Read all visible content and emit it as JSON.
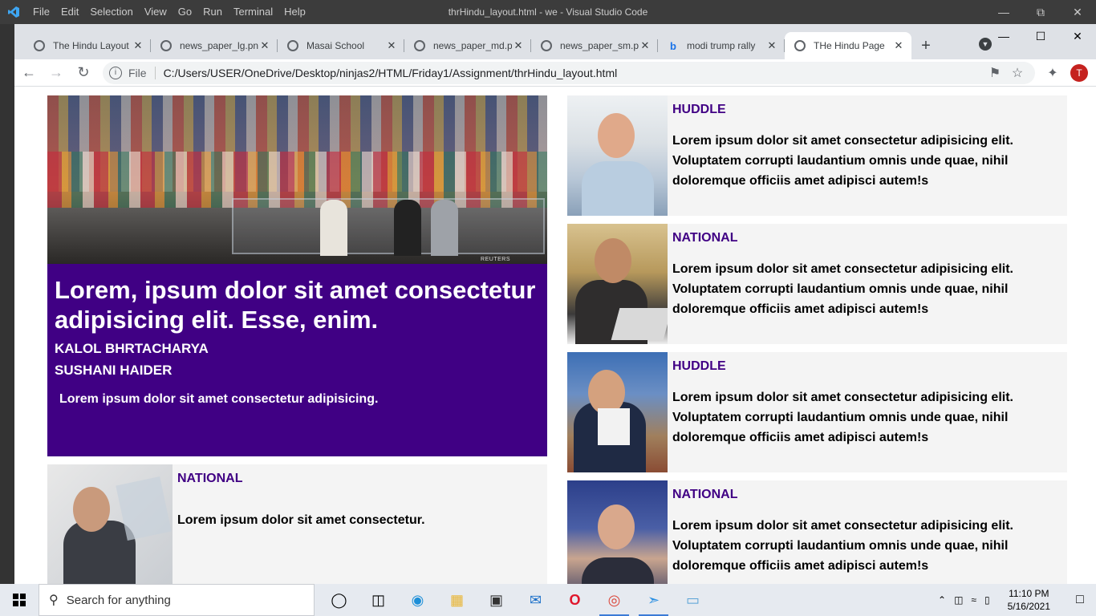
{
  "vscode": {
    "menu": [
      "File",
      "Edit",
      "Selection",
      "View",
      "Go",
      "Run",
      "Terminal",
      "Help"
    ],
    "title": "thrHindu_layout.html - we - Visual Studio Code"
  },
  "browser": {
    "tabs": [
      {
        "label": "The Hindu Layout",
        "icon": "globe-icon"
      },
      {
        "label": "news_paper_lg.png",
        "icon": "globe-icon"
      },
      {
        "label": "Masai School",
        "icon": "globe-icon"
      },
      {
        "label": "news_paper_md.png",
        "icon": "globe-icon"
      },
      {
        "label": "news_paper_sm.png",
        "icon": "globe-icon"
      },
      {
        "label": "modi trump rally",
        "icon": "bing-icon"
      },
      {
        "label": "THe Hindu Page",
        "icon": "globe-icon",
        "active": true
      }
    ],
    "address": {
      "scheme_label": "File",
      "url": "C:/Users/USER/OneDrive/Desktop/ninjas2/HTML/Friday1/Assignment/thrHindu_layout.html"
    },
    "profile_initial": "T"
  },
  "page": {
    "hero": {
      "image_credit": "REUTERS",
      "title": "Lorem, ipsum dolor sit amet consectetur adipisicing elit. Esse, enim.",
      "authors": [
        "KALOL BHRTACHARYA",
        "SUSHANI HAIDER"
      ],
      "summary": "Lorem ipsum dolor sit amet consectetur adipisicing."
    },
    "left_card": {
      "category": "NATIONAL",
      "text": "Lorem ipsum dolor sit amet consectetur."
    },
    "right_cards": [
      {
        "category": "HUDDLE",
        "text": "Lorem ipsum dolor sit amet consectetur adipisicing elit. Voluptatem corrupti laudantium omnis unde quae, nihil doloremque officiis amet adipisci autem!s"
      },
      {
        "category": "NATIONAL",
        "text": "Lorem ipsum dolor sit amet consectetur adipisicing elit. Voluptatem corrupti laudantium omnis unde quae, nihil doloremque officiis amet adipisci autem!s"
      },
      {
        "category": "HUDDLE",
        "text": "Lorem ipsum dolor sit amet consectetur adipisicing elit. Voluptatem corrupti laudantium omnis unde quae, nihil doloremque officiis amet adipisci autem!s"
      },
      {
        "category": "NATIONAL",
        "text": "Lorem ipsum dolor sit amet consectetur adipisicing elit. Voluptatem corrupti laudantium omnis unde quae, nihil doloremque officiis amet adipisci autem!s"
      }
    ],
    "colors": {
      "accent": "#400084",
      "card_bg": "#f4f4f4"
    }
  },
  "taskbar": {
    "search_placeholder": "Search for anything",
    "apps": [
      "task-view-icon",
      "edge-icon",
      "file-explorer-icon",
      "store-icon",
      "mail-icon",
      "opera-icon",
      "chrome-icon",
      "vscode-icon",
      "app-icon"
    ],
    "time": "11:10 PM",
    "date": "5/16/2021"
  }
}
